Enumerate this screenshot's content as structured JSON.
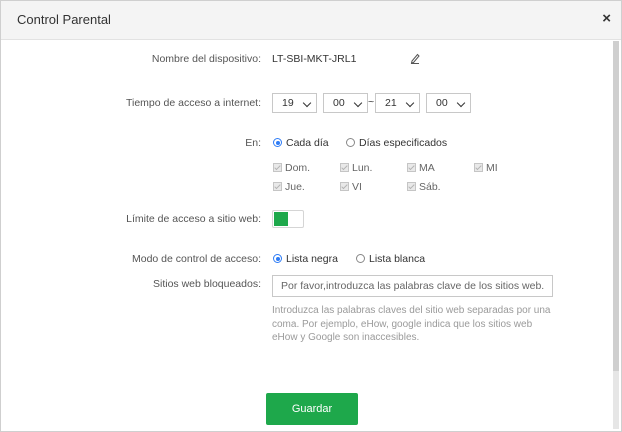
{
  "dialog": {
    "title": "Control Parental",
    "close_symbol": "×"
  },
  "device": {
    "label": "Nombre del dispositivo:",
    "value": "LT-SBI-MKT-JRL1"
  },
  "access_time": {
    "label": "Tiempo de acceso a internet:",
    "start_hour": "19",
    "start_minute": "00",
    "separator": "~",
    "end_hour": "21",
    "end_minute": "00"
  },
  "days": {
    "label": "En:",
    "option_every_day": "Cada día",
    "option_specific": "Días especificados",
    "selected": "Cada día",
    "items": [
      "Dom.",
      "Lun.",
      "MA",
      "MI",
      "Jue.",
      "VI",
      "Sáb."
    ]
  },
  "site_limit": {
    "label": "Límite de acceso a sitio web:",
    "enabled": true
  },
  "control_mode": {
    "label": "Modo de control de acceso:",
    "option_blacklist": "Lista negra",
    "option_whitelist": "Lista blanca",
    "selected": "Lista negra"
  },
  "blocked_sites": {
    "label": "Sitios web bloqueados:",
    "placeholder": "Por favor,introduzca las palabras clave de los sitios web.",
    "hint": "Introduzca las palabras claves del sitio web separadas por una coma. Por ejemplo, eHow, google indica que los sitios web eHow y Google son inaccesibles."
  },
  "buttons": {
    "save": "Guardar"
  },
  "colors": {
    "accent_green": "#1ea84b",
    "radio_blue": "#2e7cf6"
  },
  "icons": {
    "edit": "pencil-icon",
    "close": "close-icon"
  }
}
